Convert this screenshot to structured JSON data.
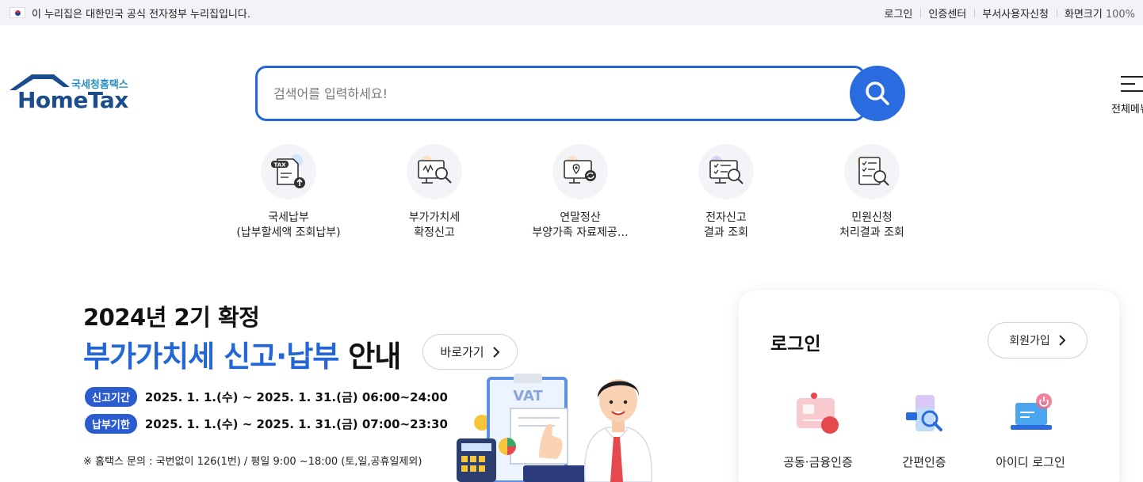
{
  "gov_bar": {
    "notice": "이 누리집은 대한민국 공식 전자정부 누리집입니다.",
    "links": [
      "로그인",
      "인증센터",
      "부서사용자신청"
    ],
    "zoom_label": "화면크기",
    "zoom_value": "100%"
  },
  "logo": {
    "sub": "국세청홈택스",
    "main": "HomeTax"
  },
  "search": {
    "placeholder": "검색어를 입력하세요!"
  },
  "all_menu": {
    "label": "전체메뉴"
  },
  "quick_menu": [
    {
      "line1": "국세납부",
      "line2": "(납부할세액 조회납부)",
      "icon": "tax-upload-icon"
    },
    {
      "line1": "부가가치세",
      "line2": "확정신고",
      "icon": "monitor-search-icon"
    },
    {
      "line1": "연말정산",
      "line2": "부양가족 자료제공…",
      "icon": "monitor-location-icon"
    },
    {
      "line1": "전자신고",
      "line2": "결과 조회",
      "icon": "checklist-monitor-icon"
    },
    {
      "line1": "민원신청",
      "line2": "처리결과 조회",
      "icon": "document-search-icon"
    }
  ],
  "banner": {
    "title1": "2024년 2기 확정",
    "title2_highlight": "부가가치세 신고·납부",
    "title2_rest": "안내",
    "go_button": "바로가기",
    "schedule": [
      {
        "tag": "신고기간",
        "text": "2025. 1. 1.(수) ~ 2025. 1. 31.(금) 06:00~24:00"
      },
      {
        "tag": "납부기한",
        "text": "2025. 1. 1.(수) ~ 2025. 1. 31.(금) 07:00~23:30"
      }
    ],
    "note": "※ 홈택스 문의 : 국번없이 126(1번) / 평일 9:00 ~18:00 (토,일,공휴일제외)",
    "vat_label": "VAT"
  },
  "login": {
    "title": "로그인",
    "join_button": "회원가입",
    "methods": [
      {
        "label": "공동·금융인증",
        "icon": "certificate-card-icon"
      },
      {
        "label": "간편인증",
        "icon": "phone-search-icon"
      },
      {
        "label": "아이디 로그인",
        "icon": "laptop-power-icon"
      }
    ]
  },
  "colors": {
    "primary": "#2266d8",
    "logo": "#1b4d8d",
    "tag": "#2b5ccf"
  }
}
